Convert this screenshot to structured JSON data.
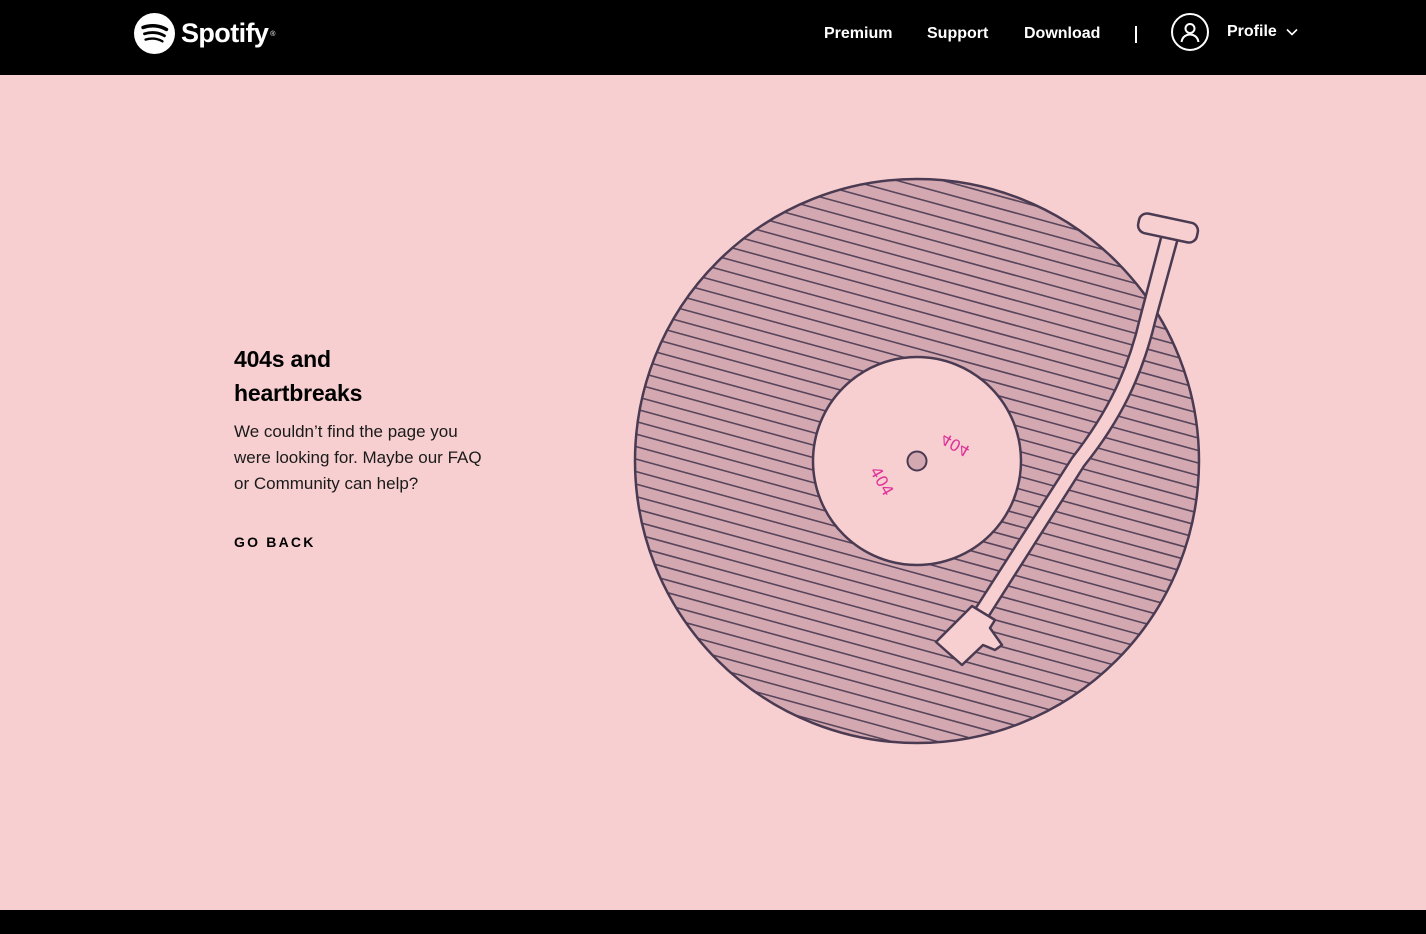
{
  "header": {
    "brand": "Spotify",
    "nav": [
      {
        "label": "Premium"
      },
      {
        "label": "Support"
      },
      {
        "label": "Download"
      }
    ],
    "profile_label": "Profile"
  },
  "main": {
    "headline_line1": "404s and",
    "headline_line2": "heartbreaks",
    "message_prefix": "We couldn’t find the page you were looking for. Maybe our ",
    "faq_link": "FAQ",
    "message_or": " or ",
    "community_link": "Community",
    "message_suffix": " can help?",
    "go_back": "GO BACK"
  },
  "illustration": {
    "label_text": "404",
    "label_text_2": "404"
  },
  "colors": {
    "background": "#f7cfd0",
    "record_fill": "#d4a8b1",
    "outline": "#4a3a52",
    "label_text": "#e0339a",
    "bar": "#000000"
  },
  "icons": {
    "logo": "spotify-logo-icon",
    "avatar": "user-avatar-icon",
    "chevron": "chevron-down-icon"
  }
}
